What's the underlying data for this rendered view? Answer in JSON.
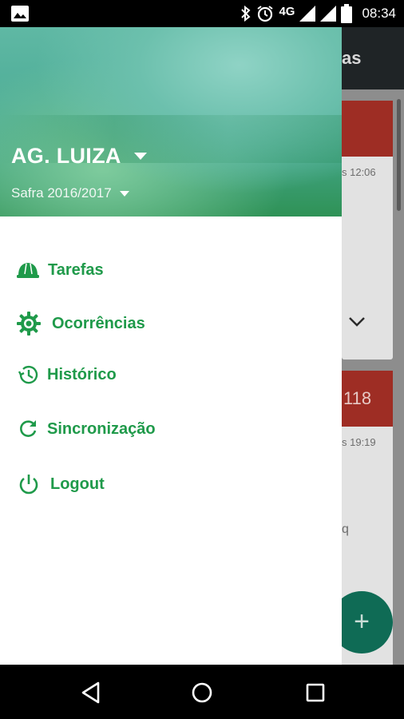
{
  "status_bar": {
    "network": "4G",
    "time": "08:34",
    "icons": [
      "gallery-icon",
      "bluetooth-icon",
      "alarm-icon",
      "signal-icon",
      "signal-icon",
      "battery-icon"
    ]
  },
  "background_app": {
    "title_fragment": "as",
    "cards": [
      {
        "head_text": "",
        "meta_text": "s 12:06"
      },
      {
        "head_text": "118",
        "meta_text": "s 19:19",
        "extra_text": "q"
      }
    ],
    "fab_label": "+"
  },
  "drawer": {
    "account_name": "AG. LUIZA",
    "season": "Safra 2016/2017",
    "menu": [
      {
        "label": "Tarefas",
        "icon": "hard-hat-icon"
      },
      {
        "label": "Ocorrências",
        "icon": "gear-icon"
      },
      {
        "label": "Histórico",
        "icon": "history-icon"
      },
      {
        "label": "Sincronização",
        "icon": "sync-icon"
      },
      {
        "label": "Logout",
        "icon": "power-icon"
      }
    ]
  },
  "colors": {
    "accent": "#1f9a4a",
    "header_green": "#3fa27f",
    "card_red": "#c0392b",
    "fab_teal": "#0f6b55"
  },
  "nav_bar": {
    "buttons": [
      "back-icon",
      "home-icon",
      "recents-icon"
    ]
  }
}
